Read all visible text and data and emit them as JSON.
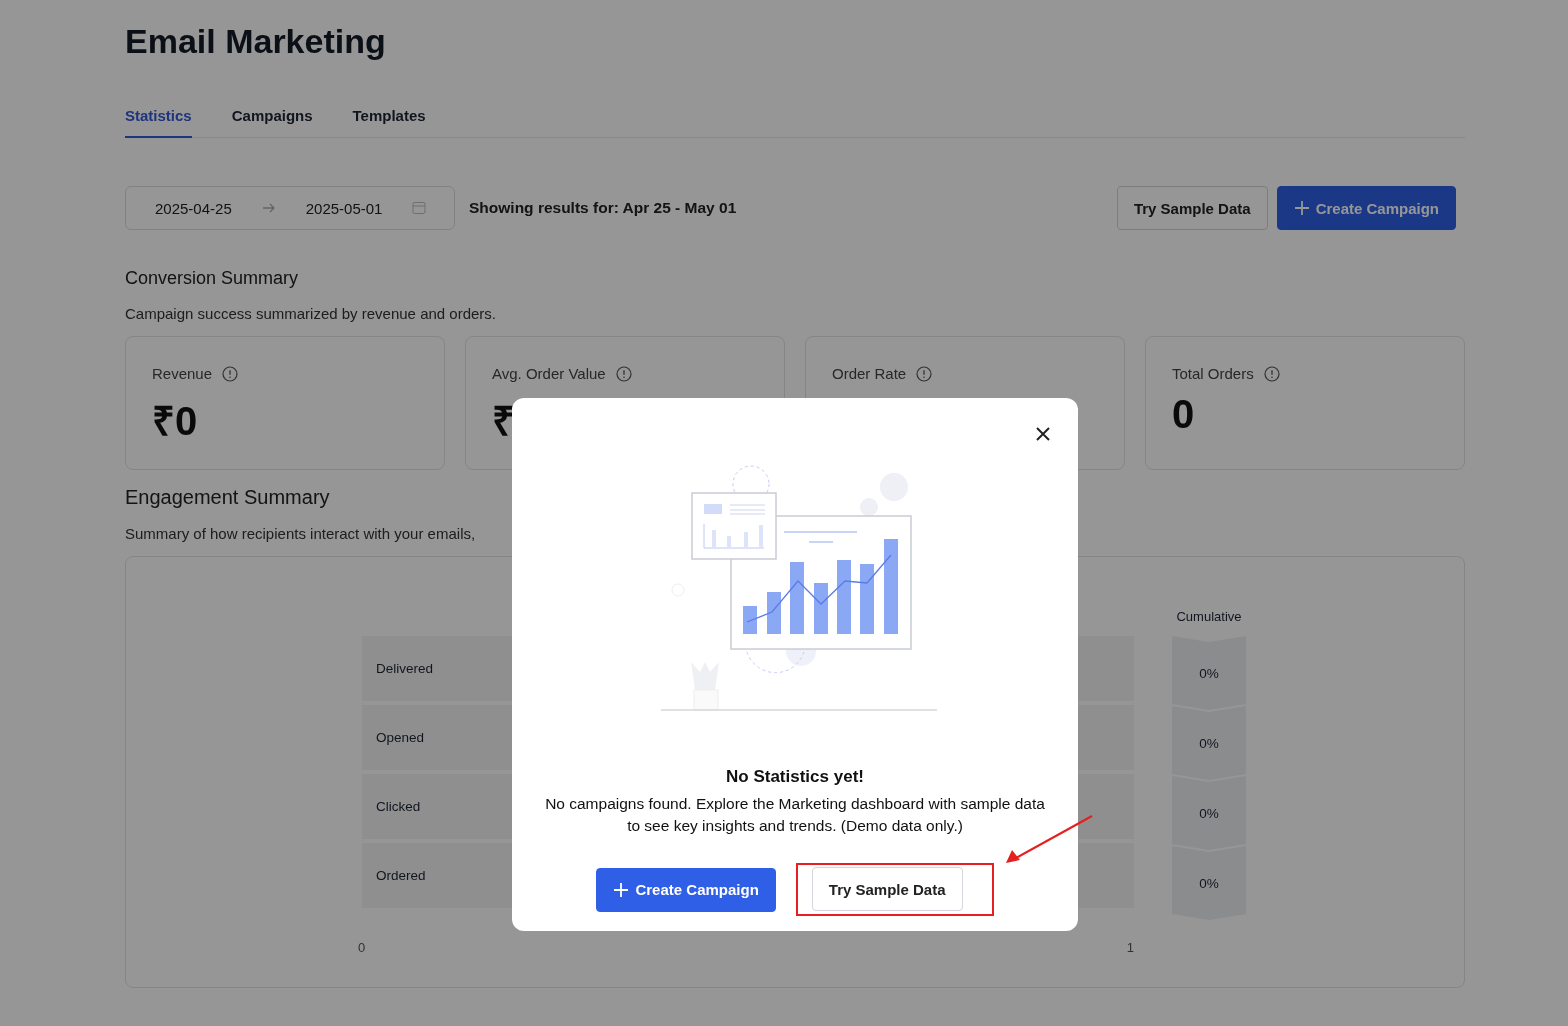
{
  "page": {
    "title": "Email Marketing"
  },
  "tabs": [
    {
      "label": "Statistics",
      "selected": true
    },
    {
      "label": "Campaigns",
      "selected": false
    },
    {
      "label": "Templates",
      "selected": false
    }
  ],
  "date_range": {
    "start": "2025-04-25",
    "end": "2025-05-01"
  },
  "results_text": "Showing results for: Apr 25 - May 01",
  "toolbar_buttons": [
    {
      "label": "Try Sample Data",
      "kind": "secondary"
    },
    {
      "label": "Create Campaign",
      "kind": "primary"
    }
  ],
  "conversion_summary": {
    "title": "Conversion Summary",
    "subtitle": "Campaign success summarized by revenue and orders.",
    "cards": [
      {
        "label": "Revenue",
        "value": "₹0"
      },
      {
        "label": "Avg. Order Value",
        "value": "₹"
      },
      {
        "label": "Order Rate"
      },
      {
        "label": "Total Orders",
        "value": "0"
      }
    ]
  },
  "engagement_summary": {
    "title": "Engagement Summary",
    "subtitle": "Summary of how recipients interact with your emails,",
    "cumulative_title": "Cumulative",
    "stages": [
      {
        "label": "Delivered",
        "cumulative": "0%"
      },
      {
        "label": "Opened",
        "cumulative": "0%"
      },
      {
        "label": "Clicked",
        "cumulative": "0%"
      },
      {
        "label": "Ordered",
        "cumulative": "0%"
      }
    ],
    "axis_labels": [
      "0",
      "1"
    ]
  },
  "modal": {
    "title": "No Statistics yet!",
    "message": "No campaigns found. Explore the Marketing dashboard with sample data to see key insights and trends. (Demo data only.)",
    "buttons": [
      {
        "label": "Create Campaign",
        "kind": "primary",
        "highlighted": false
      },
      {
        "label": "Try Sample Data",
        "kind": "secondary",
        "highlighted": true
      }
    ]
  }
}
